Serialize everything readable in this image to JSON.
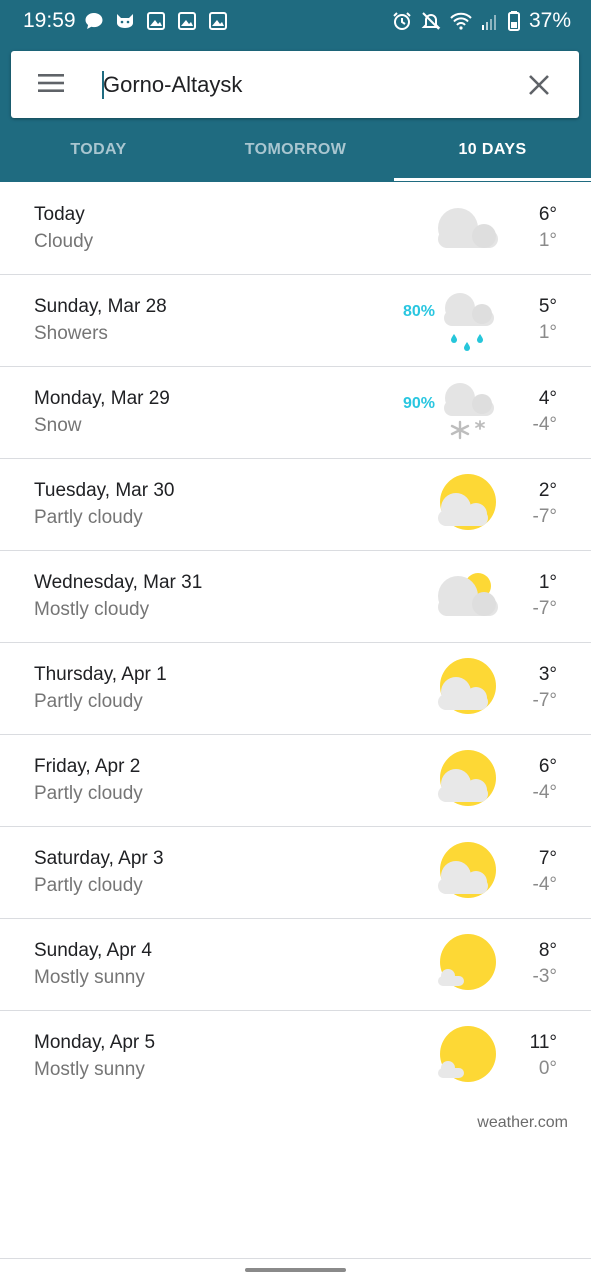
{
  "status_bar": {
    "time": "19:59",
    "battery": "37%"
  },
  "search": {
    "value": "Gorno-Altaysk"
  },
  "tabs": [
    {
      "label": "TODAY"
    },
    {
      "label": "TOMORROW"
    },
    {
      "label": "10 DAYS"
    }
  ],
  "forecast": [
    {
      "day": "Today",
      "condition": "Cloudy",
      "high": "6°",
      "low": "1°",
      "precip": "",
      "icon": "cloudy-icon"
    },
    {
      "day": "Sunday, Mar 28",
      "condition": "Showers",
      "high": "5°",
      "low": "1°",
      "precip": "80%",
      "icon": "showers-icon"
    },
    {
      "day": "Monday, Mar 29",
      "condition": "Snow",
      "high": "4°",
      "low": "-4°",
      "precip": "90%",
      "icon": "snow-icon"
    },
    {
      "day": "Tuesday, Mar 30",
      "condition": "Partly cloudy",
      "high": "2°",
      "low": "-7°",
      "precip": "",
      "icon": "partly-cloudy-icon"
    },
    {
      "day": "Wednesday, Mar 31",
      "condition": "Mostly cloudy",
      "high": "1°",
      "low": "-7°",
      "precip": "",
      "icon": "mostly-cloudy-icon"
    },
    {
      "day": "Thursday, Apr 1",
      "condition": "Partly cloudy",
      "high": "3°",
      "low": "-7°",
      "precip": "",
      "icon": "partly-cloudy-icon"
    },
    {
      "day": "Friday, Apr 2",
      "condition": "Partly cloudy",
      "high": "6°",
      "low": "-4°",
      "precip": "",
      "icon": "partly-cloudy-icon"
    },
    {
      "day": "Saturday, Apr 3",
      "condition": "Partly cloudy",
      "high": "7°",
      "low": "-4°",
      "precip": "",
      "icon": "partly-cloudy-icon"
    },
    {
      "day": "Sunday, Apr 4",
      "condition": "Mostly sunny",
      "high": "8°",
      "low": "-3°",
      "precip": "",
      "icon": "mostly-sunny-icon"
    },
    {
      "day": "Monday, Apr 5",
      "condition": "Mostly sunny",
      "high": "11°",
      "low": "0°",
      "precip": "",
      "icon": "mostly-sunny-icon"
    }
  ],
  "credit": "weather.com",
  "colors": {
    "header": "#1f6b80",
    "precip": "#29c6e0",
    "sun": "#fdd835",
    "cloud": "#e6e6e6"
  }
}
